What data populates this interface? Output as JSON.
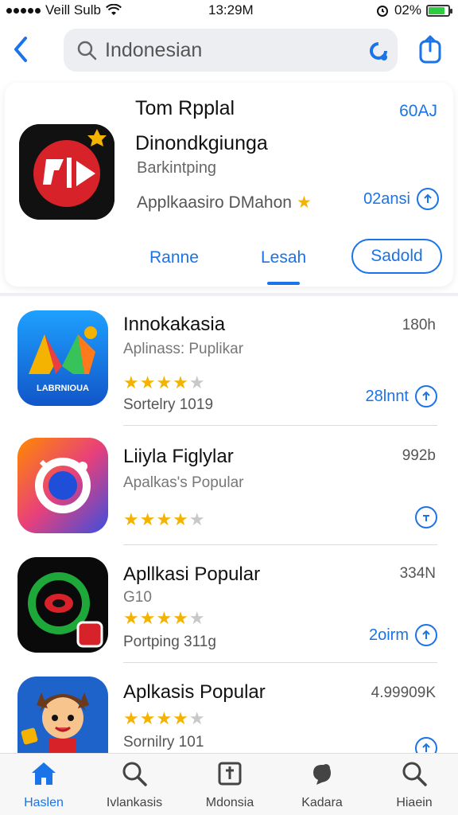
{
  "status_bar": {
    "carrier": "Veill Sulb",
    "time": "13:29M",
    "battery_text": "02%",
    "battery_level": 0.82
  },
  "search": {
    "query": "Indonesian"
  },
  "featured": {
    "title": "Tom Rpplal",
    "subtitle": "Dinondkgiunga",
    "category": "Barkintping",
    "description": "Applkaasiro DMahon",
    "corner_label": "60AJ",
    "get_label": "02ansi",
    "tabs": [
      "Ranne",
      "Lesah"
    ],
    "pill_button": "Sadold"
  },
  "apps": [
    {
      "name": "Innokakasia",
      "subtitle": "Aplinass: Puplikar",
      "rating": 4,
      "meta": "Sortelry 1019",
      "size": "180h",
      "get_label": "28lnnt",
      "icon_text": "LABRNIOUA"
    },
    {
      "name": "Liiyla Figlylar",
      "subtitle": "Apalkas's Popular",
      "rating": 4,
      "meta": "",
      "size": "992b",
      "get_label": ""
    },
    {
      "name": "Apllkasi Popular",
      "subtitle": "G10",
      "rating": 4,
      "meta": "Portping 311g",
      "size": "334N",
      "get_label": "2oirm"
    },
    {
      "name": "Aplkasis Popular",
      "subtitle": "",
      "rating": 4,
      "meta": "Sornilry 101",
      "size": "4.99909K",
      "get_label": ""
    }
  ],
  "tab_bar": {
    "items": [
      {
        "label": "Haslen",
        "icon": "home-icon"
      },
      {
        "label": "Ivlankasis",
        "icon": "search-icon"
      },
      {
        "label": "Mdonsia",
        "icon": "apps-icon"
      },
      {
        "label": "Kadara",
        "icon": "arcade-icon"
      },
      {
        "label": "Hiaein",
        "icon": "search-icon"
      }
    ]
  },
  "colors": {
    "accent": "#1a73e8",
    "star": "#f5b301"
  }
}
